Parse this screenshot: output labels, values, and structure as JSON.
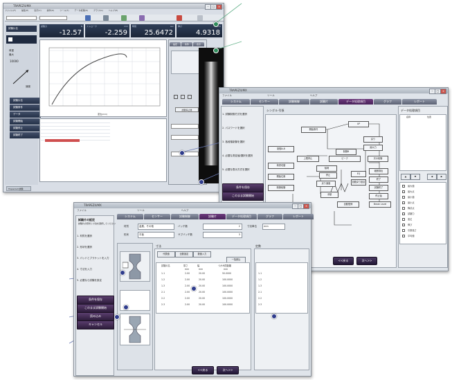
{
  "window1": {
    "title": "TRAPEZIUMX",
    "menu": [
      "ファイル(F)",
      "編集(E)",
      "表示(V)",
      "操作(O)",
      "ツール(T)",
      "データ処理(D)",
      "グラフ(G)",
      "ヘルプ(H)"
    ],
    "readouts": [
      {
        "label": "試験力",
        "unit": "N",
        "value": "-12.57"
      },
      {
        "label": "ストローク",
        "unit": "mm",
        "value": "-2.259"
      },
      {
        "label": "時間",
        "unit": "sec",
        "value": "25.6472"
      },
      {
        "label": "伸び",
        "unit": "mm",
        "value": "4.9318"
      }
    ],
    "left_panel": {
      "test_id": "試験片名",
      "load_label": "荷重",
      "speed_label": "速度",
      "max_label": "最大",
      "max_value": "10000",
      "left_buttons": [
        "試験片名",
        "試験条件",
        "データ",
        "試験開始",
        "試験停止",
        "試験終了"
      ]
    },
    "graph": {
      "xlabel": "変位(mm)"
    },
    "side_tabs": [
      "設定",
      "条件",
      "表示"
    ],
    "side_buttons": [
      "試験停止後",
      "測定中"
    ],
    "status_tab": "Trapezium試験"
  },
  "window2": {
    "title": "TRAPEZIUMX",
    "menu": [
      "ファイル",
      "ツール",
      "ヘルプ"
    ],
    "tabs": [
      "システム",
      "センサー",
      "試験制御",
      "試験片",
      "データ処理項目",
      "グラフ",
      "レポート"
    ],
    "section": "シングル-引張",
    "steps": [
      "1. 試験制御方式を選択",
      "2. パスワードを選択",
      "3. 各段階制御を選択",
      "4. 必要な測定値/選択を選択",
      "5. 必要な表示方式を選択"
    ],
    "buttons": [
      "条件を保存",
      "このまま試験開始"
    ],
    "flow": {
      "start": "開始条件",
      "control_ab": "制御A-B",
      "control_b": "制御B",
      "upper_limit": "上限停止",
      "return": "戻り",
      "next_step": "次の段階",
      "max_force": "最大力",
      "break_detect": "破断検出",
      "end": "終了",
      "test_end": "試験終了",
      "up": "UP",
      "peak": "ピーク",
      "stop": "停止",
      "return_speed": "戻り速度",
      "release": "除荷",
      "eq": "EQ",
      "switch_load": "荷重切替",
      "after_stop": "停止後",
      "start_pos": "開始位置",
      "manual": "手動",
      "auto_return": "自動復帰",
      "auto_return_enable": "自動戻り設定",
      "break_detect_label": "Break Level",
      "control_step": "制御段階"
    },
    "right_panel": {
      "title": "データ処理項目",
      "col": "名称",
      "col2": "位置",
      "items": [
        "最大値",
        "最大点",
        "最小値",
        "最小点",
        "降伏点",
        "試験力",
        "変位",
        "伸び",
        "引張強さ",
        "平均値"
      ],
      "extra": [
        "平均値",
        "平均値"
      ]
    },
    "nav": [
      "<<戻る",
      "次へ>>"
    ]
  },
  "window3": {
    "title": "TRAPEZIUMX",
    "menu": [
      "ファイル",
      "ツール",
      "ヘルプ"
    ],
    "tabs": [
      "システム",
      "センサー",
      "試験制御",
      "試験片",
      "データ処理項目",
      "グラフ",
      "レポート"
    ],
    "heading": "試験片の設定",
    "heading_desc": "試験片の形状と寸法を選択してください",
    "steps": [
      "1. 材質を選択",
      "2. 形状を選択",
      "3. パッドとブラケットを入力",
      "4. 寸法を入力",
      "5. 必要なら試験を設定"
    ],
    "material": {
      "label": "材質",
      "value": "金属、その他"
    },
    "shape": {
      "label": "形状",
      "value": "平板"
    },
    "batch": {
      "label": "バッチ数",
      "value": "2"
    },
    "subbatch": {
      "label": "サブバッチ数",
      "value": "3"
    },
    "dim_unit": {
      "label": "寸法単位",
      "value": "mm"
    },
    "dims_title": "寸法",
    "dim_buttons": [
      "代表値",
      "全数設定",
      "数値入力",
      "一括読込"
    ],
    "consts_title": "定数",
    "table": {
      "headers": [
        "試験片名",
        "厚さ",
        "幅",
        "つかみ間距離"
      ],
      "units": [
        "",
        "mm",
        "mm",
        "mm"
      ],
      "rows": [
        [
          "1-1",
          "2.00",
          "20.00",
          "50.0000"
        ],
        [
          "1-2",
          "2.00",
          "20.00",
          "100.0000"
        ],
        [
          "1-3",
          "2.00",
          "20.00",
          "100.0000"
        ],
        [
          "2-1",
          "2.00",
          "20.00",
          "100.0000"
        ],
        [
          "2-2",
          "2.00",
          "20.00",
          "100.0000"
        ],
        [
          "2-3",
          "2.00",
          "20.00",
          "100.0000"
        ]
      ],
      "consts": [
        "1-1",
        "1-2",
        "1-3",
        "2-1",
        "2-2",
        "2-3"
      ]
    },
    "save_buttons": [
      "条件を保存",
      "このまま試験開始",
      "読み込み",
      "キャンセル"
    ],
    "nav": [
      "<<戻る",
      "次へ>>"
    ],
    "right_items": [
      "名前",
      "重量",
      "長さ",
      "確認"
    ]
  }
}
